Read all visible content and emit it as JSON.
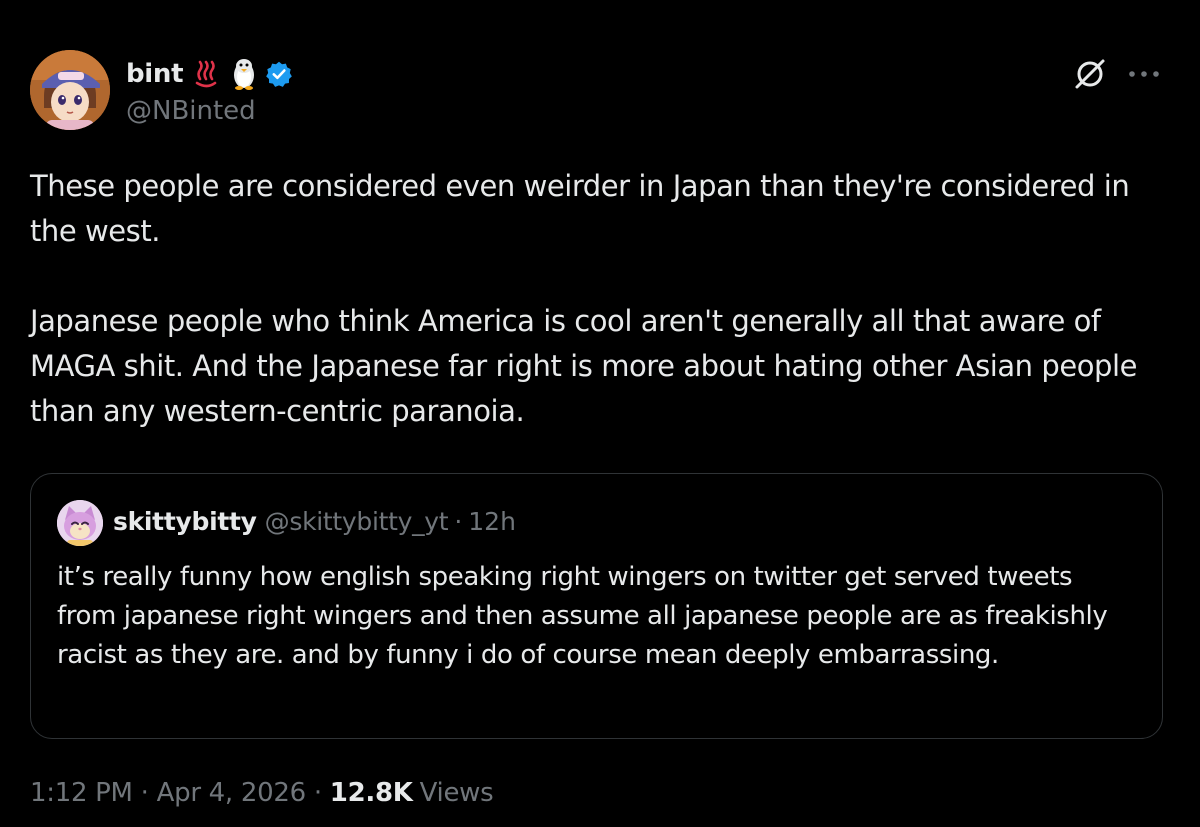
{
  "author": {
    "display_name": "bint",
    "emojis": [
      "hot-springs-emoji",
      "penguin-emoji"
    ],
    "verified": true,
    "handle": "@NBinted"
  },
  "tweet": {
    "paragraphs": [
      "These people are considered even weirder in Japan than they're considered in the west.",
      "Japanese people who think America is cool aren't generally all that aware of MAGA shit. And the Japanese far right is more about hating other Asian people than any western-centric paranoia."
    ]
  },
  "quoted_tweet": {
    "display_name": "skittybitty",
    "handle": "@skittybitty_yt",
    "separator": "·",
    "time": "12h",
    "text": "it’s really funny how english speaking right wingers on twitter get served tweets from japanese right wingers and then assume all japanese people are as freakishly racist as they are. and by funny i do of course mean deeply embarrassing."
  },
  "meta": {
    "time": "1:12 PM",
    "date": "Apr 4, 2026",
    "separator": "·",
    "views_count": "12.8K",
    "views_label": "Views"
  },
  "icons": {
    "grok": "grok-icon",
    "more": "more-icon",
    "verified": "verified-badge-icon"
  },
  "colors": {
    "background": "#000000",
    "text_primary": "#e7e9ea",
    "text_secondary": "#71767b",
    "border": "#2f3336",
    "verified_blue": "#1d9bf0"
  }
}
